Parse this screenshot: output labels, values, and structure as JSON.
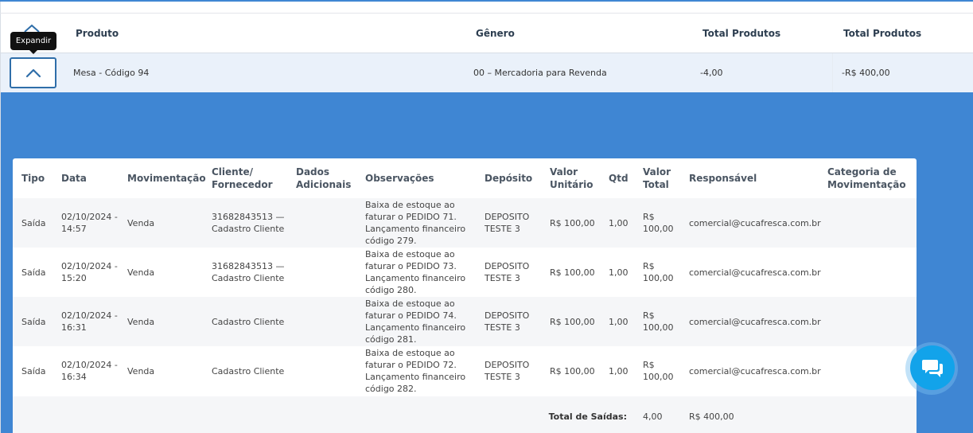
{
  "main_table": {
    "headers": {
      "produto": "Produto",
      "genero": "Gênero",
      "total_produtos_1": "Total Produtos",
      "total_produtos_2": "Total Produtos"
    },
    "row": {
      "produto": "Mesa - Código 94",
      "genero": "00 – Mercadoria para Revenda",
      "total_qtd": "-4,00",
      "total_valor": "-R$ 400,00"
    }
  },
  "tooltip": {
    "text": "Expandir"
  },
  "detail_table": {
    "headers": {
      "tipo": "Tipo",
      "data": "Data",
      "movimentacao": "Movimentação",
      "cliente": "Cliente/ Fornecedor",
      "dados": "Dados Adicionais",
      "observacoes": "Observações",
      "deposito": "Depósito",
      "valor_unitario": "Valor Unitário",
      "qtd": "Qtd",
      "valor_total": "Valor Total",
      "responsavel": "Responsável",
      "categoria": "Categoria de Movimentação"
    },
    "rows": [
      {
        "tipo": "Saída",
        "data": "02/10/2024 - 14:57",
        "movimentacao": "Venda",
        "cliente": "31682843513 — Cadastro Cliente",
        "dados": "",
        "observacoes": "Baixa de estoque ao faturar o PEDIDO 71. Lançamento financeiro código 279.",
        "deposito": "DEPOSITO TESTE 3",
        "valor_unitario": "R$ 100,00",
        "qtd": "1,00",
        "valor_total": "R$ 100,00",
        "responsavel": "comercial@cucafresca.com.br",
        "categoria": ""
      },
      {
        "tipo": "Saída",
        "data": "02/10/2024 - 15:20",
        "movimentacao": "Venda",
        "cliente": "31682843513 — Cadastro Cliente",
        "dados": "",
        "observacoes": "Baixa de estoque ao faturar o PEDIDO 73. Lançamento financeiro código 280.",
        "deposito": "DEPOSITO TESTE 3",
        "valor_unitario": "R$ 100,00",
        "qtd": "1,00",
        "valor_total": "R$ 100,00",
        "responsavel": "comercial@cucafresca.com.br",
        "categoria": ""
      },
      {
        "tipo": "Saída",
        "data": "02/10/2024 - 16:31",
        "movimentacao": "Venda",
        "cliente": "Cadastro Cliente",
        "dados": "",
        "observacoes": "Baixa de estoque ao faturar o PEDIDO 74. Lançamento financeiro código 281.",
        "deposito": "DEPOSITO TESTE 3",
        "valor_unitario": "R$ 100,00",
        "qtd": "1,00",
        "valor_total": "R$ 100,00",
        "responsavel": "comercial@cucafresca.com.br",
        "categoria": ""
      },
      {
        "tipo": "Saída",
        "data": "02/10/2024 - 16:34",
        "movimentacao": "Venda",
        "cliente": "Cadastro Cliente",
        "dados": "",
        "observacoes": "Baixa de estoque ao faturar o PEDIDO 72. Lançamento financeiro código 282.",
        "deposito": "DEPOSITO TESTE 3",
        "valor_unitario": "R$ 100,00",
        "qtd": "1,00",
        "valor_total": "R$ 100,00",
        "responsavel": "comercial@cucafresca.com.br",
        "categoria": ""
      }
    ],
    "footer": {
      "label": "Total de Saídas:",
      "qtd": "4,00",
      "valor": "R$ 400,00"
    }
  },
  "icons": {
    "expand": "chevron-up-icon",
    "chat": "chat-icon"
  },
  "colors": {
    "accent": "#3f86d3",
    "fab": "#12a3ea",
    "button_border": "#2f6ea9"
  }
}
